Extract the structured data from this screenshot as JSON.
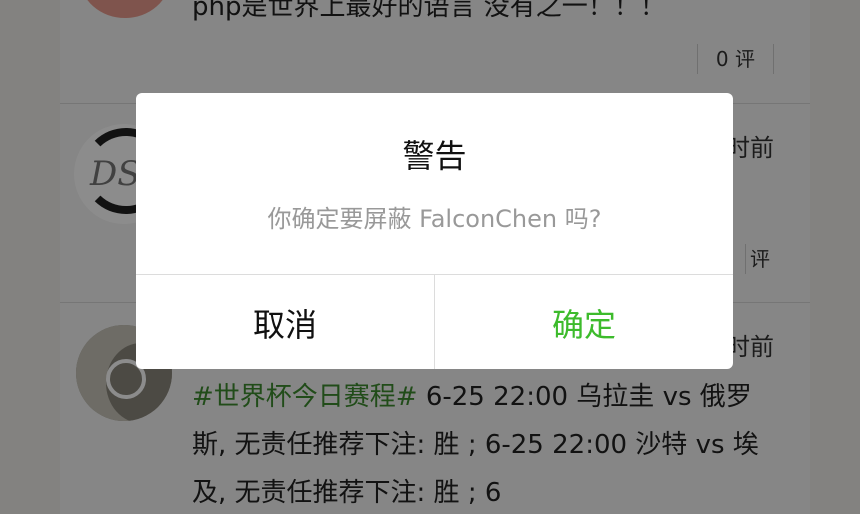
{
  "feed": {
    "post1": {
      "text": "php是世界上最好的语言 没有之一！！！",
      "comment_label": "0 评"
    },
    "post2": {
      "avatar_text": "DSL",
      "time_label": "时前",
      "comment_label": "评"
    },
    "post3": {
      "time_label": "时前",
      "hashtag": "#世界杯今日赛程#",
      "body": " 6-25 22:00 乌拉圭 vs 俄罗斯, 无责任推荐下注: 胜 ; 6-25 22:00 沙特 vs 埃及, 无责任推荐下注: 胜 ; 6"
    }
  },
  "dialog": {
    "title": "警告",
    "message": "你确定要屏蔽 FalconChen 吗?",
    "cancel_label": "取消",
    "confirm_label": "确定"
  },
  "colors": {
    "confirm": "#3dbb2c",
    "hashtag": "#3c8b2f",
    "overlay": "rgba(0,0,0,0.45)"
  }
}
